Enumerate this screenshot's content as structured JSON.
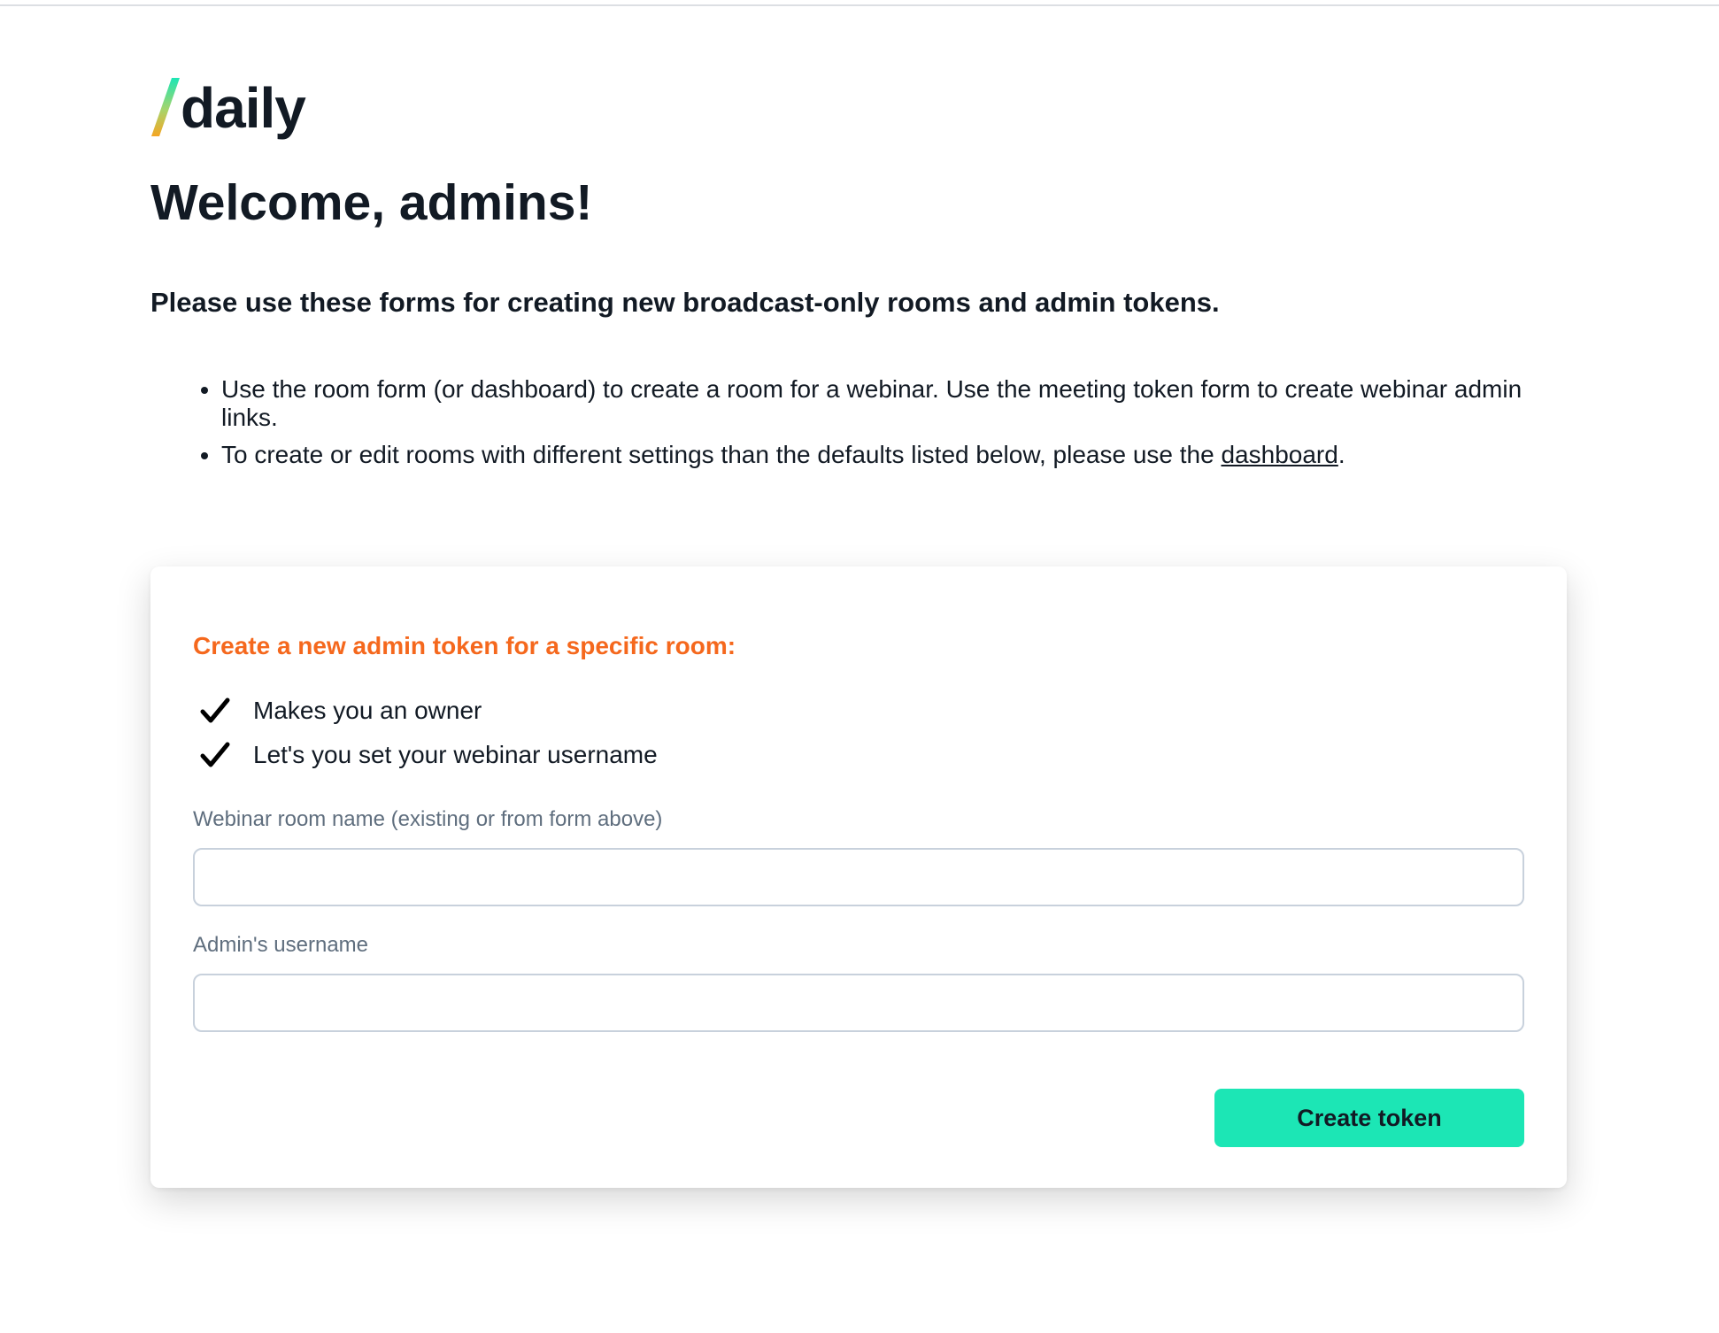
{
  "logo": {
    "wordmark": "daily",
    "slash_colors": [
      "#1ce6b5",
      "#f5a623"
    ]
  },
  "header": {
    "title": "Welcome, admins!",
    "subtitle": "Please use these forms for creating new broadcast-only rooms and admin tokens."
  },
  "notes": {
    "item1": "Use the room form (or dashboard) to create a room for a webinar. Use the meeting token form to create webinar admin links.",
    "item2_prefix": "To create or edit rooms with different settings than the defaults listed below, please use the ",
    "item2_link": "dashboard",
    "item2_suffix": "."
  },
  "token_form": {
    "title": "Create a new admin token for a specific room:",
    "features": [
      "Makes you an owner",
      "Let's you set your webinar username"
    ],
    "room_name_label": "Webinar room name (existing or from form above)",
    "room_name_value": "",
    "username_label": "Admin's username",
    "username_value": "",
    "submit_label": "Create token"
  },
  "colors": {
    "accent_orange": "#f5681d",
    "button_teal": "#1ce6b5",
    "text_dark": "#121a24",
    "label_gray": "#5f6e7e"
  }
}
